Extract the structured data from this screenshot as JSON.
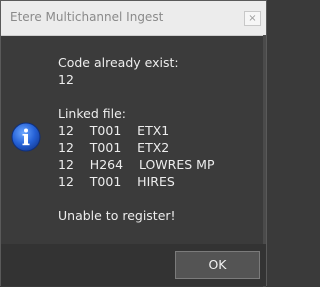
{
  "window": {
    "title": "Etere Multichannel Ingest",
    "close_glyph": "×"
  },
  "dialog": {
    "icon": "info-icon",
    "lines": [
      "Code already exist:",
      "12",
      "",
      "Linked file:",
      "12    T001    ETX1",
      "12    T001    ETX2",
      "12    H264    LOWRES MP",
      "12    T001    HIRES",
      "",
      "Unable to register!"
    ]
  },
  "buttons": {
    "ok_label": "OK"
  },
  "colors": {
    "icon_blue": "#1f5fd1",
    "background": "#3b3b3b"
  }
}
